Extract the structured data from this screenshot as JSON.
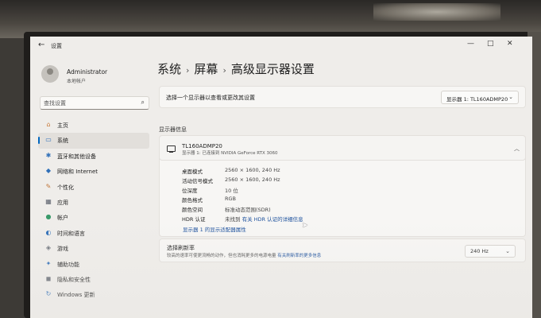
{
  "window": {
    "app_title": "设置",
    "minimize": "—",
    "maximize": "□",
    "close": "✕",
    "back": "←"
  },
  "user": {
    "name": "Administrator",
    "account_type": "本地帐户"
  },
  "search": {
    "placeholder": "查找设置",
    "icon": "search-icon"
  },
  "sidebar": {
    "items": [
      {
        "label": "主页",
        "icon": "home-icon",
        "glyph": "⌂",
        "color": "#c97a3a"
      },
      {
        "label": "系统",
        "icon": "system-icon",
        "glyph": "▭",
        "color": "#2f6fb8",
        "active": true
      },
      {
        "label": "蓝牙和其他设备",
        "icon": "bluetooth-icon",
        "glyph": "✱",
        "color": "#2f6fb8"
      },
      {
        "label": "网络和 Internet",
        "icon": "wifi-icon",
        "glyph": "◆",
        "color": "#2f6fb8"
      },
      {
        "label": "个性化",
        "icon": "brush-icon",
        "glyph": "✎",
        "color": "#c0763a"
      },
      {
        "label": "应用",
        "icon": "apps-icon",
        "glyph": "▦",
        "color": "#5a5f6b"
      },
      {
        "label": "帐户",
        "icon": "account-icon",
        "glyph": "●",
        "color": "#3a9a6a"
      },
      {
        "label": "时间和语言",
        "icon": "clock-globe-icon",
        "glyph": "◐",
        "color": "#2f6fb8"
      },
      {
        "label": "游戏",
        "icon": "game-controller-icon",
        "glyph": "◈",
        "color": "#6a6f78"
      },
      {
        "label": "辅助功能",
        "icon": "accessibility-icon",
        "glyph": "✦",
        "color": "#2f6fb8"
      },
      {
        "label": "隐私和安全性",
        "icon": "shield-icon",
        "glyph": "◼",
        "color": "#6a6f78"
      },
      {
        "label": "Windows 更新",
        "icon": "update-icon",
        "glyph": "↻",
        "color": "#2f6fb8"
      }
    ]
  },
  "breadcrumb": {
    "items": [
      "系统",
      "屏幕",
      "高级显示器设置"
    ],
    "separator": "›"
  },
  "select_display": {
    "label": "选择一个显示器以查看或更改其设置",
    "value": "显示器 1: TL160ADMP20"
  },
  "display_info": {
    "section_title": "显示器信息",
    "monitor_name": "TL160ADMP20",
    "monitor_sub": "显示器 1: 已连接到 NVIDIA GeForce RTX 3060",
    "rows": [
      {
        "label": "桌面模式",
        "value": "2560 × 1600, 240 Hz"
      },
      {
        "label": "活动信号模式",
        "value": "2560 × 1600, 240 Hz"
      },
      {
        "label": "位深度",
        "value": "10 位"
      },
      {
        "label": "颜色格式",
        "value": "RGB"
      },
      {
        "label": "颜色空间",
        "value": "标准动态范围(SDR)"
      }
    ],
    "hdr": {
      "label": "HDR 认证",
      "value_prefix": "未找到",
      "link": "有关 HDR 认证的详细信息"
    },
    "adapter_link": "显示器 1 的显示适配器属性"
  },
  "refresh_rate": {
    "title": "选择刷新率",
    "description": "较高的速率可使更流畅的动作，但也消耗更多的电源电量",
    "link": "有关刷新率的更多信息",
    "value": "240 Hz"
  }
}
